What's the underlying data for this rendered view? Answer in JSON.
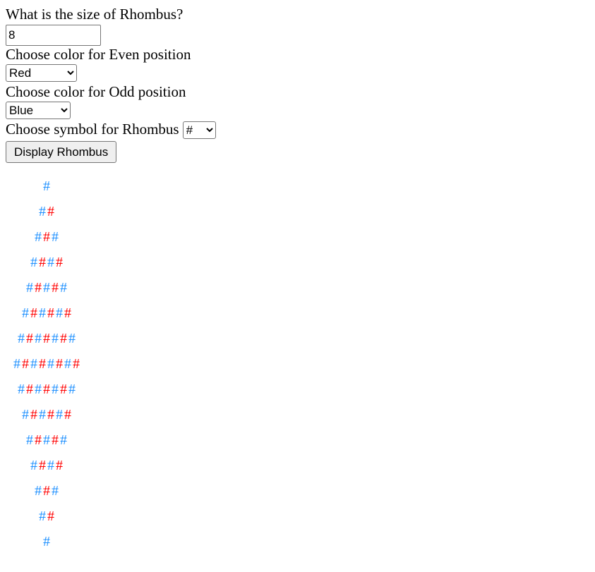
{
  "form": {
    "size_label": "What is the size of Rhombus?",
    "size_value": "8",
    "even_label": "Choose color for Even position",
    "even_value": "Red",
    "odd_label": "Choose color for Odd position",
    "odd_value": "Blue",
    "symbol_label": "Choose symbol for Rhombus",
    "symbol_value": "#",
    "display_button": "Display Rhombus"
  },
  "rhombus": {
    "size": 8,
    "symbol": "#",
    "odd_color": "#1e90ff",
    "even_color": "#ff0000",
    "rows": [
      "#",
      "##",
      "###",
      "####",
      "#####",
      "######",
      "#######",
      "########",
      "#######",
      "######",
      "#####",
      "####",
      "###",
      "##",
      "#"
    ]
  }
}
